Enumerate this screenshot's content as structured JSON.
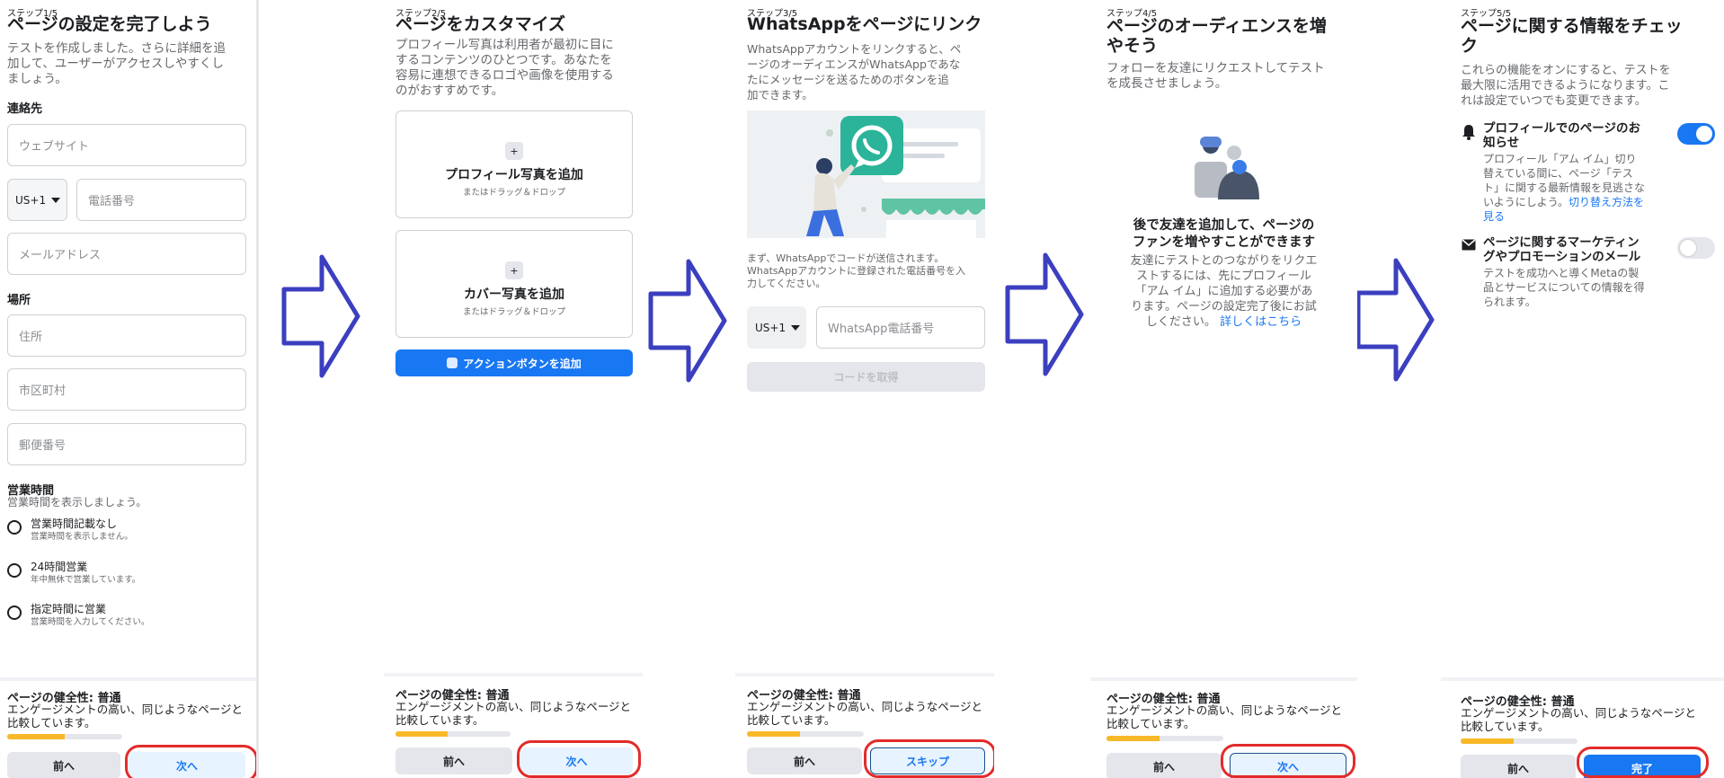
{
  "colors": {
    "accent": "#1877f2",
    "progress": "#f7b928",
    "highlight_ring": "#e32b2b",
    "arrow": "#3b3fbf"
  },
  "footer": {
    "health_title": "ページの健全性: 普通",
    "health_desc_line1": "エンゲージメントの高い、同じようなページと",
    "health_desc_line2": "比較しています。",
    "back_label": "前へ",
    "progress_fraction": 0.22
  },
  "step1": {
    "step": "ステップ1/5",
    "title": "ページの設定を完了しよう",
    "desc_line1": "テストを作成しました。さらに詳細を追",
    "desc_line2": "加して、ユーザーがアクセスしやすくし",
    "desc_line3": "ましょう。",
    "contact_label": "連絡先",
    "website_placeholder": "ウェブサイト",
    "country_code": "US+1",
    "phone_placeholder": "電話番号",
    "email_placeholder": "メールアドレス",
    "location_label": "場所",
    "address_placeholder": "住所",
    "city_placeholder": "市区町村",
    "zip_placeholder": "郵便番号",
    "hours_label": "営業時間",
    "hours_desc": "営業時間を表示しましょう。",
    "hours_options": [
      {
        "title": "営業時間記載なし",
        "sub": "営業時間を表示しません。"
      },
      {
        "title": "24時間営業",
        "sub": "年中無休で営業しています。"
      },
      {
        "title": "指定時間に営業",
        "sub": "営業時間を入力してください。"
      }
    ],
    "next_label": "次へ"
  },
  "step2": {
    "step": "ステップ2/5",
    "title": "ページをカスタマイズ",
    "desc_line1": "プロフィール写真は利用者が最初に目に",
    "desc_line2": "するコンテンツのひとつです。あなたを",
    "desc_line3": "容易に連想できるロゴや画像を使用する",
    "desc_line4": "のがおすすめです。",
    "profile_photo": "プロフィール写真を追加",
    "cover_photo": "カバー写真を追加",
    "drag_hint": "またはドラッグ＆ドロップ",
    "action_button": "アクションボタンを追加",
    "next_label": "次へ"
  },
  "step3": {
    "step": "ステップ3/5",
    "title": "WhatsAppをページにリンク",
    "desc_line1": "WhatsAppアカウントをリンクすると、ペ",
    "desc_line2": "ージのオーディエンスがWhatsAppであな",
    "desc_line3": "たにメッセージを送るためのボタンを追",
    "desc_line4": "加できます。",
    "code_note_line1": "まず、WhatsAppでコードが送信されます。",
    "code_note_line2": "WhatsAppアカウントに登録された電話番号を入",
    "code_note_line3": "力してください。",
    "country_code": "US+1",
    "phone_placeholder": "WhatsApp電話番号",
    "get_code": "コードを取得",
    "skip_label": "スキップ"
  },
  "step4": {
    "step": "ステップ4/5",
    "title_line1": "ページのオーディエンスを増",
    "title_line2": "やそう",
    "desc_line1": "フォローを友達にリクエストしてテスト",
    "desc_line2": "を成長させましょう。",
    "empty_title_line1": "後で友達を追加して、ページの",
    "empty_title_line2": "ファンを増やすことができます",
    "empty_desc_line1": "友達にテストとのつながりをリクエ",
    "empty_desc_line2": "ストするには、先にプロフィール",
    "empty_desc_line3": "「アム イム」に追加する必要があ",
    "empty_desc_line4": "ります。ページの設定完了後にお試",
    "empty_desc_line5": "しください。",
    "learn_more": "詳しくはこちら",
    "next_label": "次へ"
  },
  "step5": {
    "step": "ステップ5/5",
    "title_line1": "ページに関する情報をチェッ",
    "title_line2": "ク",
    "desc_line1": "これらの機能をオンにすると、テストを",
    "desc_line2": "最大限に活用できるようになります。こ",
    "desc_line3": "れは設定でいつでも変更できます。",
    "notif1_title_line1": "プロフィールでのページのお",
    "notif1_title_line2": "知らせ",
    "notif1_desc_line1": "プロフィール「アム イム」切り",
    "notif1_desc_line2": "替えている間に、ページ「テス",
    "notif1_desc_line3": "ト」に関する最新情報を見逃さな",
    "notif1_desc_line4": "いようにしよう。",
    "notif1_link": "切り替え方法を",
    "notif1_link2": "見る",
    "notif1_enabled": true,
    "notif2_title_line1": "ページに関するマーケティン",
    "notif2_title_line2": "グやプロモーションのメール",
    "notif2_desc_line1": "テストを成功へと導くMetaの製",
    "notif2_desc_line2": "品とサービスについての情報を得",
    "notif2_desc_line3": "られます。",
    "notif2_enabled": false,
    "done_label": "完了"
  }
}
